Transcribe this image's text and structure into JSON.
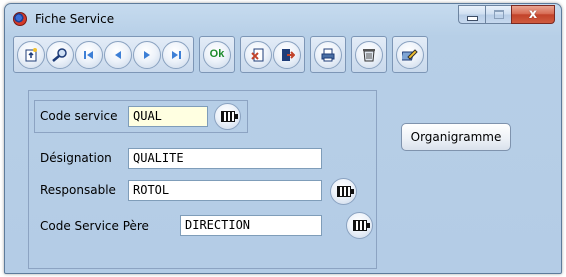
{
  "window": {
    "title": "Fiche Service",
    "close_glyph": "x"
  },
  "toolbar": {
    "groups": [
      [
        "new-record",
        "search",
        "first-record",
        "previous-record",
        "next-record",
        "last-record"
      ],
      [
        "ok"
      ],
      [
        "cancel",
        "exit"
      ],
      [
        "print"
      ],
      [
        "delete"
      ],
      [
        "notes"
      ]
    ],
    "ok_label": "Ok"
  },
  "form": {
    "code_service": {
      "label": "Code service",
      "value": "QUAL"
    },
    "designation": {
      "label": "Désignation",
      "value": "QUALITE"
    },
    "responsable": {
      "label": "Responsable",
      "value": "ROTOL"
    },
    "code_service_pere": {
      "label": "Code Service Père",
      "value": "DIRECTION"
    }
  },
  "organigramme_button": {
    "label": "Organigramme"
  },
  "colors": {
    "title_bar": "#c6dbef",
    "window_body": "#b4cce6",
    "code_field_bg": "#ffffe1",
    "ok_green": "#1b8a2a",
    "close_red": "#c2432a"
  }
}
